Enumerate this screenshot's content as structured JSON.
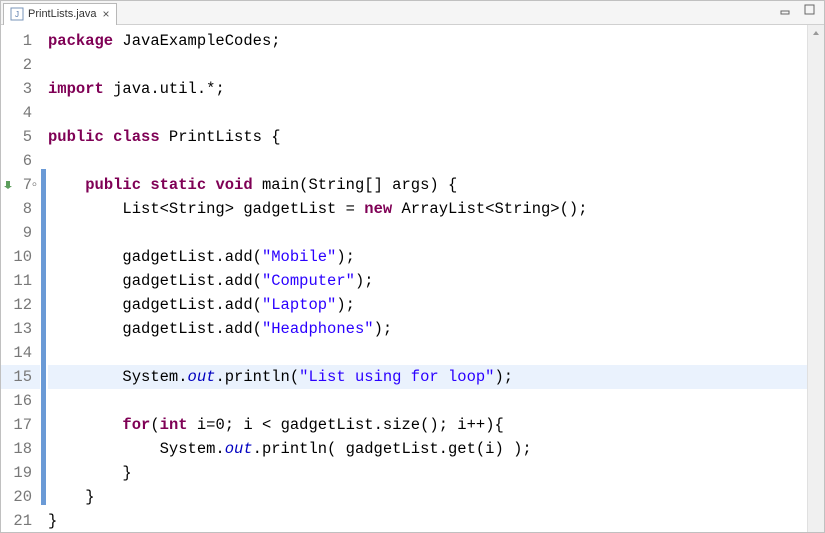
{
  "tab": {
    "filename": "PrintLists.java"
  },
  "gutter": {
    "lines": [
      "1",
      "2",
      "3",
      "4",
      "5",
      "6",
      "7",
      "8",
      "9",
      "10",
      "11",
      "12",
      "13",
      "14",
      "15",
      "16",
      "17",
      "18",
      "19",
      "20",
      "21"
    ],
    "override_line": 7,
    "highlighted_line": 15
  },
  "code": {
    "lines": [
      [
        {
          "t": "package ",
          "c": "kw"
        },
        {
          "t": "JavaExampleCodes;",
          "c": "plain"
        }
      ],
      [],
      [
        {
          "t": "import ",
          "c": "kw"
        },
        {
          "t": "java.util.*;",
          "c": "plain"
        }
      ],
      [],
      [
        {
          "t": "public class ",
          "c": "kw"
        },
        {
          "t": "PrintLists {",
          "c": "plain"
        }
      ],
      [],
      [
        {
          "t": "    ",
          "c": "plain"
        },
        {
          "t": "public static void ",
          "c": "kw"
        },
        {
          "t": "main(String[] args) {",
          "c": "plain"
        }
      ],
      [
        {
          "t": "        List<String> gadgetList = ",
          "c": "plain"
        },
        {
          "t": "new ",
          "c": "kw"
        },
        {
          "t": "ArrayList<String>();",
          "c": "plain"
        }
      ],
      [],
      [
        {
          "t": "        gadgetList.add(",
          "c": "plain"
        },
        {
          "t": "\"Mobile\"",
          "c": "str"
        },
        {
          "t": ");",
          "c": "plain"
        }
      ],
      [
        {
          "t": "        gadgetList.add(",
          "c": "plain"
        },
        {
          "t": "\"Computer\"",
          "c": "str"
        },
        {
          "t": ");",
          "c": "plain"
        }
      ],
      [
        {
          "t": "        gadgetList.add(",
          "c": "plain"
        },
        {
          "t": "\"Laptop\"",
          "c": "str"
        },
        {
          "t": ");",
          "c": "plain"
        }
      ],
      [
        {
          "t": "        gadgetList.add(",
          "c": "plain"
        },
        {
          "t": "\"Headphones\"",
          "c": "str"
        },
        {
          "t": ");",
          "c": "plain"
        }
      ],
      [],
      [
        {
          "t": "        System.",
          "c": "plain"
        },
        {
          "t": "out",
          "c": "field"
        },
        {
          "t": ".println(",
          "c": "plain"
        },
        {
          "t": "\"List using for loop\"",
          "c": "str"
        },
        {
          "t": ");",
          "c": "plain"
        }
      ],
      [],
      [
        {
          "t": "        ",
          "c": "plain"
        },
        {
          "t": "for",
          "c": "kw"
        },
        {
          "t": "(",
          "c": "plain"
        },
        {
          "t": "int ",
          "c": "kw"
        },
        {
          "t": "i=0; i < gadgetList.size(); i++){",
          "c": "plain"
        }
      ],
      [
        {
          "t": "            System.",
          "c": "plain"
        },
        {
          "t": "out",
          "c": "field"
        },
        {
          "t": ".println( gadgetList.get(i) );",
          "c": "plain"
        }
      ],
      [
        {
          "t": "        }",
          "c": "plain"
        }
      ],
      [
        {
          "t": "    }",
          "c": "plain"
        }
      ],
      [
        {
          "t": "}",
          "c": "plain"
        }
      ]
    ],
    "highlighted_line": 15,
    "method_marker_start": 7,
    "method_marker_end": 20
  }
}
